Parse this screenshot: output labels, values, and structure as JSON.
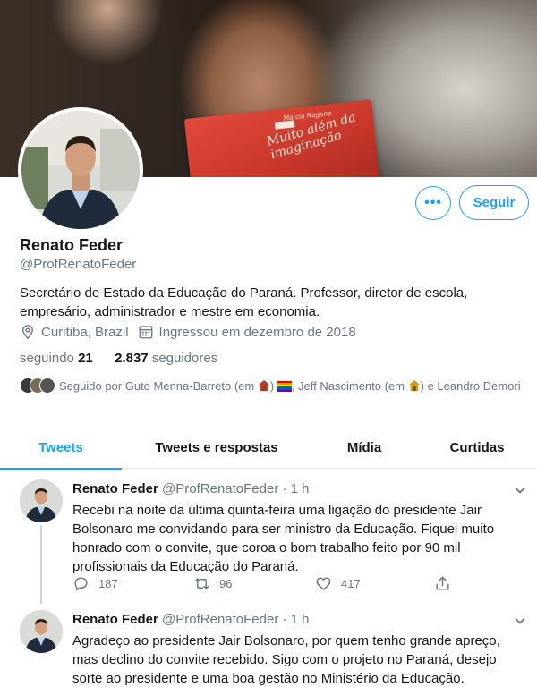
{
  "profile": {
    "name": "Renato Feder",
    "handle": "@ProfRenatoFeder",
    "bio": "Secretário de Estado da Educação do Paraná. Professor, diretor de escola, empresário, administrador e mestre em economia.",
    "location": "Curitiba, Brazil",
    "joined": "Ingressou em dezembro de 2018",
    "following_label": "seguindo",
    "following_count": "21",
    "followers_count": "2.837",
    "followers_label": "seguidores",
    "followed_by_prefix": "Seguido por Guto Menna-Barreto (em ",
    "followed_by_mid": ", Jeff Nascimento (em ",
    "followed_by_suffix": ") e Leandro Demori",
    "followed_by_close1": ")",
    "more_button": "•••",
    "follow_button": "Seguir"
  },
  "banner": {
    "book_title": "Muito além da imaginação",
    "book_author": "Marcia Ragone"
  },
  "tabs": [
    {
      "label": "Tweets"
    },
    {
      "label": "Tweets e respostas"
    },
    {
      "label": "Mídia"
    },
    {
      "label": "Curtidas"
    }
  ],
  "tweets": [
    {
      "name": "Renato Feder",
      "handle": "@ProfRenatoFeder",
      "time": "· 1 h",
      "text": "Recebi na noite da última quinta-feira uma ligação do presidente Jair Bolsonaro me convidando para ser ministro da Educação. Fiquei muito honrado com o convite, que coroa o bom trabalho feito por 90 mil profissionais da Educação do Paraná.",
      "replies": "187",
      "retweets": "96",
      "likes": "417"
    },
    {
      "name": "Renato Feder",
      "handle": "@ProfRenatoFeder",
      "time": "· 1 h",
      "text": "Agradeço ao presidente Jair Bolsonaro, por quem tenho grande apreço, mas declino do convite recebido. Sigo com o projeto no Paraná, desejo sorte ao presidente e uma boa gestão no Ministério da Educação."
    }
  ],
  "colors": {
    "accent": "#1da1f2",
    "text": "#14171a",
    "muted": "#657786",
    "border": "#e6ecf0"
  }
}
